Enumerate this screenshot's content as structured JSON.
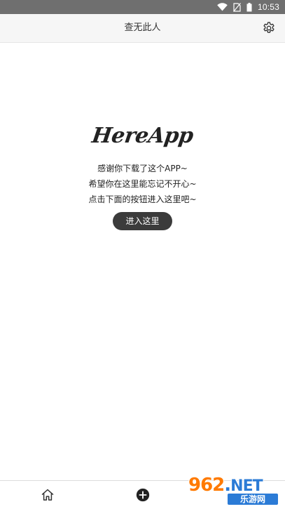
{
  "status_bar": {
    "time": "10:53",
    "icons": [
      "wifi-icon",
      "no-sim-icon",
      "battery-icon"
    ]
  },
  "header": {
    "title": "查无此人",
    "settings_icon": "gear-icon"
  },
  "main": {
    "logo_text": "HereApp",
    "message_lines": [
      "感谢你下载了这个APP~",
      "希望你在这里能忘记不开心~",
      "点击下面的按钮进入这里吧~"
    ],
    "enter_button_label": "进入这里"
  },
  "bottom_nav": {
    "items": [
      {
        "icon": "home-icon"
      },
      {
        "icon": "add-circle-icon"
      }
    ]
  },
  "watermark": {
    "number": "962",
    "dot": ".",
    "suffix": "NET",
    "subtitle": "乐游网"
  },
  "colors": {
    "status_bar": "#6f6f6f",
    "header_bg": "#f6f6f6",
    "button_bg": "#3b3b3b",
    "watermark_orange": "#ff8a00",
    "watermark_blue": "#2b7bd6"
  }
}
